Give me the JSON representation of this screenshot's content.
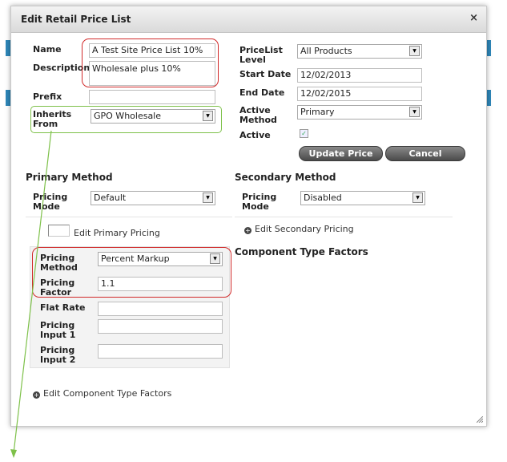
{
  "dialog": {
    "title": "Edit Retail Price List",
    "close_symbol": "×"
  },
  "form": {
    "name_label": "Name",
    "name_value": "A Test Site Price List 10%",
    "description_label": "Description",
    "description_value": "Wholesale plus 10%",
    "prefix_label": "Prefix",
    "prefix_value": "",
    "inherits_label_1": "Inherits",
    "inherits_label_2": "From",
    "inherits_value": "GPO Wholesale",
    "pricelist_level_label_1": "PriceList",
    "pricelist_level_label_2": "Level",
    "pricelist_level_value": "All Products",
    "start_date_label": "Start Date",
    "start_date_value": "12/02/2013",
    "end_date_label": "End Date",
    "end_date_value": "12/02/2015",
    "active_method_label_1": "Active",
    "active_method_label_2": "Method",
    "active_method_value": "Primary",
    "active_label": "Active",
    "active_checked": true
  },
  "buttons": {
    "update": "Update Price List",
    "cancel": "Cancel"
  },
  "primary": {
    "heading": "Primary Method",
    "pricing_mode_label_1": "Pricing",
    "pricing_mode_label_2": "Mode",
    "pricing_mode_value": "Default",
    "edit_link": "Edit Primary Pricing",
    "pricing_method_label_1": "Pricing",
    "pricing_method_label_2": "Method",
    "pricing_method_value": "Percent Markup",
    "pricing_factor_label_1": "Pricing",
    "pricing_factor_label_2": "Factor",
    "pricing_factor_value": "1.1",
    "flat_rate_label": "Flat Rate",
    "flat_rate_value": "",
    "pricing_input1_label_1": "Pricing",
    "pricing_input1_label_2": "Input 1",
    "pricing_input1_value": "",
    "pricing_input2_label_1": "Pricing",
    "pricing_input2_label_2": "Input 2",
    "pricing_input2_value": ""
  },
  "secondary": {
    "heading": "Secondary Method",
    "pricing_mode_label_1": "Pricing",
    "pricing_mode_label_2": "Mode",
    "pricing_mode_value": "Disabled",
    "edit_link": "Edit Secondary Pricing"
  },
  "component": {
    "heading": "Component Type Factors",
    "edit_link": "Edit Component Type Factors"
  },
  "colors": {
    "highlight_red": "#d12a2a",
    "highlight_green": "#7ec14a",
    "button_dark": "#4a4a4a"
  }
}
